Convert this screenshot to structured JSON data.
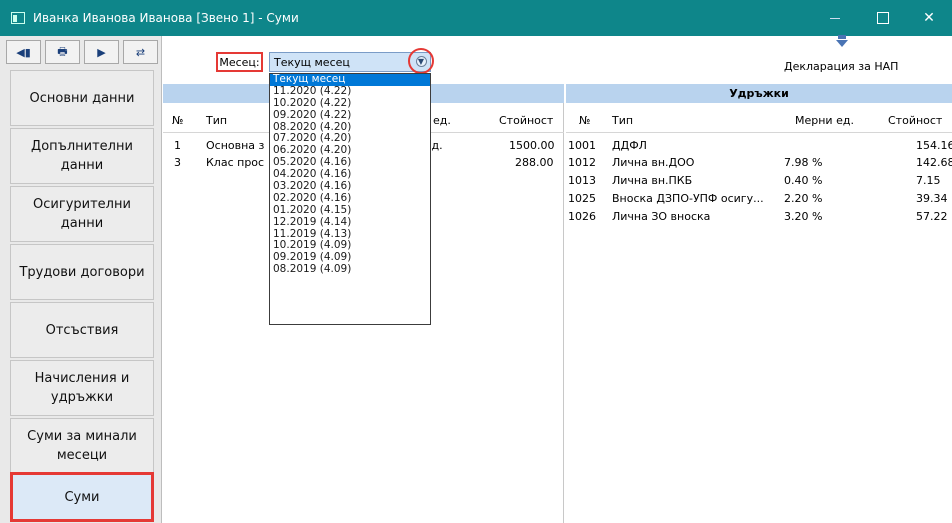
{
  "window": {
    "title": "Иванка Иванова Иванова [Звено 1] - Суми",
    "minimize": "—",
    "maximize": "☐",
    "close": "✕"
  },
  "nav_toolbar": [
    {
      "icon": "first-record-icon",
      "glyph": "◀▮"
    },
    {
      "icon": "print-icon",
      "glyph": "🖶"
    },
    {
      "icon": "next-record-icon",
      "glyph": "▶"
    },
    {
      "icon": "refresh-icon",
      "glyph": "⇄"
    }
  ],
  "sidebar": [
    {
      "label": "Основни данни",
      "active": false
    },
    {
      "label": "Допълнителни данни",
      "active": false
    },
    {
      "label": "Осигурителни данни",
      "active": false
    },
    {
      "label": "Трудови договори",
      "active": false
    },
    {
      "label": "Отсъствия",
      "active": false
    },
    {
      "label": "Начисления и удръжки",
      "active": false
    },
    {
      "label": "Суми за минали месеци",
      "active": false
    },
    {
      "label": "Суми",
      "active": true
    }
  ],
  "month": {
    "label": "Месец:",
    "selected": "Текущ месец",
    "options": [
      "Текущ месец",
      "11.2020 (4.22)",
      "10.2020 (4.22)",
      "09.2020 (4.22)",
      "08.2020 (4.20)",
      "07.2020 (4.20)",
      "06.2020 (4.20)",
      "05.2020 (4.16)",
      "04.2020 (4.16)",
      "03.2020 (4.16)",
      "02.2020 (4.16)",
      "01.2020 (4.15)",
      "12.2019 (4.14)",
      "11.2019 (4.13)",
      "10.2019 (4.09)",
      "09.2019 (4.09)",
      "08.2019 (4.09)"
    ]
  },
  "nap": {
    "label": "Декларация за НАП"
  },
  "accruals": {
    "columns": {
      "no": "№",
      "type": "Тип",
      "unit": "ед.",
      "value": "Стойност"
    },
    "rows": [
      {
        "no": "1",
        "type": "Основна з",
        "unit": "р.д.",
        "value": "1500.00"
      },
      {
        "no": "3",
        "type": "Клас прос",
        "unit": "%",
        "value": "288.00"
      }
    ]
  },
  "deductions": {
    "title": "Удръжки",
    "columns": {
      "no": "№",
      "type": "Тип",
      "unit": "Мерни ед.",
      "value": "Стойност"
    },
    "rows": [
      {
        "no": "1001",
        "type": "ДДФЛ",
        "unit": "",
        "value": "154.16"
      },
      {
        "no": "1012",
        "type": "Лична вн.ДОО",
        "unit": "7.98 %",
        "value": "142.68"
      },
      {
        "no": "1013",
        "type": "Лична вн.ПКБ",
        "unit": "0.40 %",
        "value": "7.15"
      },
      {
        "no": "1025",
        "type": "Вноска ДЗПО-УПФ осигу...",
        "unit": "2.20 %",
        "value": "39.34"
      },
      {
        "no": "1026",
        "type": "Лична ЗО вноска",
        "unit": "3.20 %",
        "value": "57.22"
      }
    ]
  }
}
